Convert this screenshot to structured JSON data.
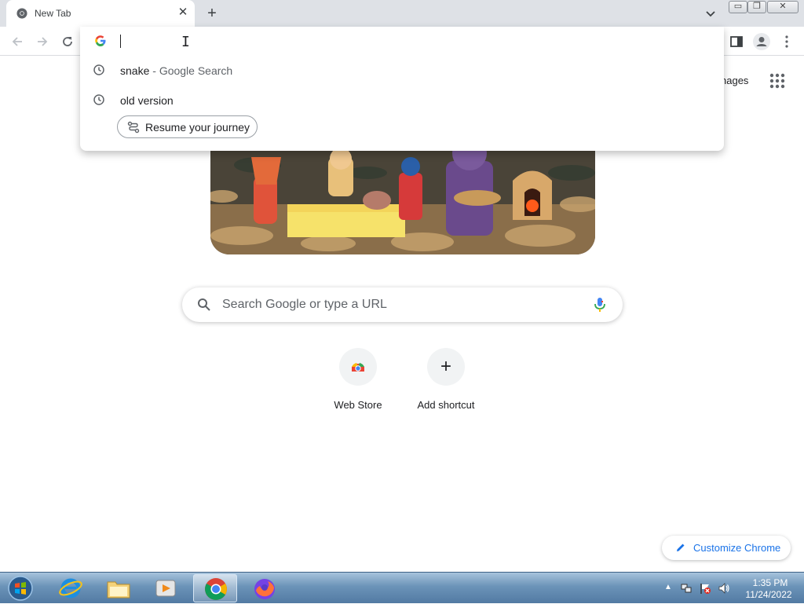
{
  "tab": {
    "title": "New Tab",
    "close": "✕",
    "new_tab": "+"
  },
  "window_controls": {
    "minimize": "▭",
    "maximize": "❐",
    "close": "✕"
  },
  "omnibox": {
    "value": "",
    "suggestions": [
      {
        "query": "snake",
        "separator": " - ",
        "source": "Google Search"
      },
      {
        "query": "old version",
        "separator": "",
        "source": ""
      }
    ],
    "journey_chip": "Resume your journey"
  },
  "ntp": {
    "images_link": "nages",
    "search_placeholder": "Search Google or type a URL",
    "shortcuts": [
      {
        "label": "Web Store",
        "glyph": ""
      },
      {
        "label": "Add shortcut",
        "glyph": "+"
      }
    ],
    "customize_label": "Customize Chrome"
  },
  "taskbar": {
    "apps": [
      "internet-explorer",
      "windows-explorer",
      "media-player",
      "chrome",
      "firefox"
    ],
    "tray_arrow": "▲",
    "clock_time": "1:35 PM",
    "clock_date": "11/24/2022"
  },
  "colors": {
    "accent": "#1a73e8",
    "tabstrip": "#dee1e6",
    "taskbar": "#6b93b8"
  }
}
